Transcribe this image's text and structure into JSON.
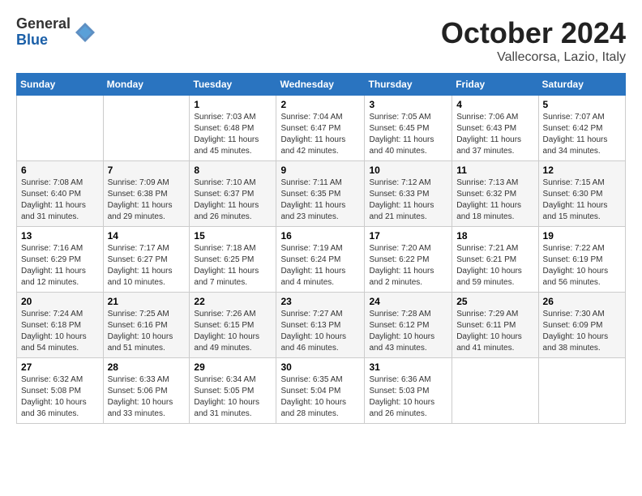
{
  "header": {
    "logo_general": "General",
    "logo_blue": "Blue",
    "month_title": "October 2024",
    "location": "Vallecorsa, Lazio, Italy"
  },
  "days_of_week": [
    "Sunday",
    "Monday",
    "Tuesday",
    "Wednesday",
    "Thursday",
    "Friday",
    "Saturday"
  ],
  "weeks": [
    [
      {
        "day": "",
        "info": ""
      },
      {
        "day": "",
        "info": ""
      },
      {
        "day": "1",
        "info": "Sunrise: 7:03 AM\nSunset: 6:48 PM\nDaylight: 11 hours and 45 minutes."
      },
      {
        "day": "2",
        "info": "Sunrise: 7:04 AM\nSunset: 6:47 PM\nDaylight: 11 hours and 42 minutes."
      },
      {
        "day": "3",
        "info": "Sunrise: 7:05 AM\nSunset: 6:45 PM\nDaylight: 11 hours and 40 minutes."
      },
      {
        "day": "4",
        "info": "Sunrise: 7:06 AM\nSunset: 6:43 PM\nDaylight: 11 hours and 37 minutes."
      },
      {
        "day": "5",
        "info": "Sunrise: 7:07 AM\nSunset: 6:42 PM\nDaylight: 11 hours and 34 minutes."
      }
    ],
    [
      {
        "day": "6",
        "info": "Sunrise: 7:08 AM\nSunset: 6:40 PM\nDaylight: 11 hours and 31 minutes."
      },
      {
        "day": "7",
        "info": "Sunrise: 7:09 AM\nSunset: 6:38 PM\nDaylight: 11 hours and 29 minutes."
      },
      {
        "day": "8",
        "info": "Sunrise: 7:10 AM\nSunset: 6:37 PM\nDaylight: 11 hours and 26 minutes."
      },
      {
        "day": "9",
        "info": "Sunrise: 7:11 AM\nSunset: 6:35 PM\nDaylight: 11 hours and 23 minutes."
      },
      {
        "day": "10",
        "info": "Sunrise: 7:12 AM\nSunset: 6:33 PM\nDaylight: 11 hours and 21 minutes."
      },
      {
        "day": "11",
        "info": "Sunrise: 7:13 AM\nSunset: 6:32 PM\nDaylight: 11 hours and 18 minutes."
      },
      {
        "day": "12",
        "info": "Sunrise: 7:15 AM\nSunset: 6:30 PM\nDaylight: 11 hours and 15 minutes."
      }
    ],
    [
      {
        "day": "13",
        "info": "Sunrise: 7:16 AM\nSunset: 6:29 PM\nDaylight: 11 hours and 12 minutes."
      },
      {
        "day": "14",
        "info": "Sunrise: 7:17 AM\nSunset: 6:27 PM\nDaylight: 11 hours and 10 minutes."
      },
      {
        "day": "15",
        "info": "Sunrise: 7:18 AM\nSunset: 6:25 PM\nDaylight: 11 hours and 7 minutes."
      },
      {
        "day": "16",
        "info": "Sunrise: 7:19 AM\nSunset: 6:24 PM\nDaylight: 11 hours and 4 minutes."
      },
      {
        "day": "17",
        "info": "Sunrise: 7:20 AM\nSunset: 6:22 PM\nDaylight: 11 hours and 2 minutes."
      },
      {
        "day": "18",
        "info": "Sunrise: 7:21 AM\nSunset: 6:21 PM\nDaylight: 10 hours and 59 minutes."
      },
      {
        "day": "19",
        "info": "Sunrise: 7:22 AM\nSunset: 6:19 PM\nDaylight: 10 hours and 56 minutes."
      }
    ],
    [
      {
        "day": "20",
        "info": "Sunrise: 7:24 AM\nSunset: 6:18 PM\nDaylight: 10 hours and 54 minutes."
      },
      {
        "day": "21",
        "info": "Sunrise: 7:25 AM\nSunset: 6:16 PM\nDaylight: 10 hours and 51 minutes."
      },
      {
        "day": "22",
        "info": "Sunrise: 7:26 AM\nSunset: 6:15 PM\nDaylight: 10 hours and 49 minutes."
      },
      {
        "day": "23",
        "info": "Sunrise: 7:27 AM\nSunset: 6:13 PM\nDaylight: 10 hours and 46 minutes."
      },
      {
        "day": "24",
        "info": "Sunrise: 7:28 AM\nSunset: 6:12 PM\nDaylight: 10 hours and 43 minutes."
      },
      {
        "day": "25",
        "info": "Sunrise: 7:29 AM\nSunset: 6:11 PM\nDaylight: 10 hours and 41 minutes."
      },
      {
        "day": "26",
        "info": "Sunrise: 7:30 AM\nSunset: 6:09 PM\nDaylight: 10 hours and 38 minutes."
      }
    ],
    [
      {
        "day": "27",
        "info": "Sunrise: 6:32 AM\nSunset: 5:08 PM\nDaylight: 10 hours and 36 minutes."
      },
      {
        "day": "28",
        "info": "Sunrise: 6:33 AM\nSunset: 5:06 PM\nDaylight: 10 hours and 33 minutes."
      },
      {
        "day": "29",
        "info": "Sunrise: 6:34 AM\nSunset: 5:05 PM\nDaylight: 10 hours and 31 minutes."
      },
      {
        "day": "30",
        "info": "Sunrise: 6:35 AM\nSunset: 5:04 PM\nDaylight: 10 hours and 28 minutes."
      },
      {
        "day": "31",
        "info": "Sunrise: 6:36 AM\nSunset: 5:03 PM\nDaylight: 10 hours and 26 minutes."
      },
      {
        "day": "",
        "info": ""
      },
      {
        "day": "",
        "info": ""
      }
    ]
  ]
}
